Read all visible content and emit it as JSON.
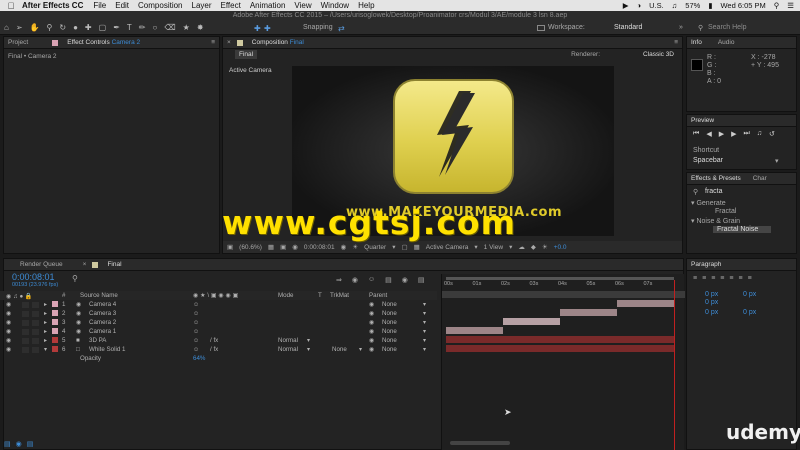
{
  "menubar": {
    "apple_icon": "apple-icon",
    "app_name": "After Effects CC",
    "items": [
      "File",
      "Edit",
      "Composition",
      "Layer",
      "Effect",
      "Animation",
      "View",
      "Window",
      "Help"
    ],
    "status": {
      "region": "U.S.",
      "battery": "57%",
      "clock": "Wed 6:05 PM"
    }
  },
  "window_title": "Adobe After Effects CC 2015 – /Users/urisoglowek/Desktop/Proanimator crs/Modul 3/AE/module 3 lsn 8.aep",
  "toolbar": {
    "snapping": "Snapping",
    "workspace_label": "Workspace:",
    "workspace_value": "Standard",
    "search_placeholder": "Search Help"
  },
  "project_panel": {
    "tab_project": "Project",
    "tab_effect_controls": "Effect Controls",
    "tab_effect_controls_target": "Camera 2",
    "breadcrumb": "Final • Camera 2"
  },
  "comp_panel": {
    "tab_label": "Composition",
    "tab_target": "Final",
    "subtab": "Final",
    "renderer_label": "Renderer:",
    "renderer_value": "Classic 3D",
    "view_label": "Active Camera",
    "canvas_text": "www.MAKEYOURMEDIA.com",
    "footer": {
      "zoom": "(60.6%)",
      "timecode": "0:00:08:01",
      "resolution": "Quarter",
      "camera": "Active Camera",
      "views": "1 View",
      "offset": "+0.0"
    }
  },
  "watermark": "www.cgtsj.com",
  "info_panel": {
    "tab_info": "Info",
    "tab_audio": "Audio",
    "r": "R :",
    "g": "G :",
    "b": "B :",
    "a": "A : 0",
    "x": "X : -278",
    "y": "+ Y : 495"
  },
  "preview_panel": {
    "title": "Preview",
    "shortcut_label": "Shortcut",
    "shortcut_value": "Spacebar"
  },
  "effects_panel": {
    "tab_effects": "Effects & Presets",
    "tab_char": "Char",
    "search_value": "fracta",
    "groups": [
      {
        "name": "Generate",
        "items": [
          "Fractal"
        ]
      },
      {
        "name": "Noise & Grain",
        "items": [
          "Fractal Noise"
        ]
      }
    ]
  },
  "paragraph_panel": {
    "title": "Paragraph",
    "px": [
      "0 px",
      "0 px",
      "0 px",
      "0 px",
      "0 px"
    ]
  },
  "timeline": {
    "tab_render_queue": "Render Queue",
    "tab_final": "Final",
    "timecode": "0:00:08:01",
    "fps": "00193 (23.976 fps)",
    "headers": {
      "num": "#",
      "source": "Source Name",
      "mode": "Mode",
      "t": "T",
      "trkmat": "TrkMat",
      "parent": "Parent"
    },
    "ruler": [
      "00s",
      "01s",
      "02s",
      "03s",
      "04s",
      "05s",
      "06s",
      "07s"
    ],
    "layers": [
      {
        "num": "1",
        "name": "Camera 4",
        "color": "#d9a3b4",
        "mode": "",
        "trkmat": "",
        "parent": "None",
        "bar_start": 0.75,
        "bar_end": 1.0,
        "bar_color": "#9d8588"
      },
      {
        "num": "2",
        "name": "Camera 3",
        "color": "#d9a3b4",
        "mode": "",
        "trkmat": "",
        "parent": "None",
        "bar_start": 0.5,
        "bar_end": 0.75,
        "bar_color": "#9d8588"
      },
      {
        "num": "3",
        "name": "Camera 2",
        "color": "#d9a3b4",
        "mode": "",
        "trkmat": "",
        "parent": "None",
        "bar_start": 0.25,
        "bar_end": 0.5,
        "bar_color": "#b6a0a4"
      },
      {
        "num": "4",
        "name": "Camera 1",
        "color": "#d9a3b4",
        "mode": "",
        "trkmat": "",
        "parent": "None",
        "bar_start": 0.0,
        "bar_end": 0.25,
        "bar_color": "#9d8588"
      },
      {
        "num": "5",
        "name": "3D PA",
        "color": "#b23a3a",
        "mode": "Normal",
        "trkmat": "",
        "parent": "None",
        "bar_start": 0.0,
        "bar_end": 1.0,
        "bar_color": "#7a2a2a"
      },
      {
        "num": "6",
        "name": "White Solid 1",
        "color": "#b23a3a",
        "mode": "Normal",
        "trkmat": "None",
        "parent": "None",
        "bar_start": 0.0,
        "bar_end": 1.0,
        "bar_color": "#7a2a2a"
      }
    ],
    "opacity_label": "Opacity",
    "opacity_value": "64%",
    "playhead": 1.0
  },
  "udemy": "udemy",
  "colors": {
    "accent": "#3d8cd6",
    "logo_yellow": "#e8db5c",
    "watermark": "#ffe100"
  }
}
